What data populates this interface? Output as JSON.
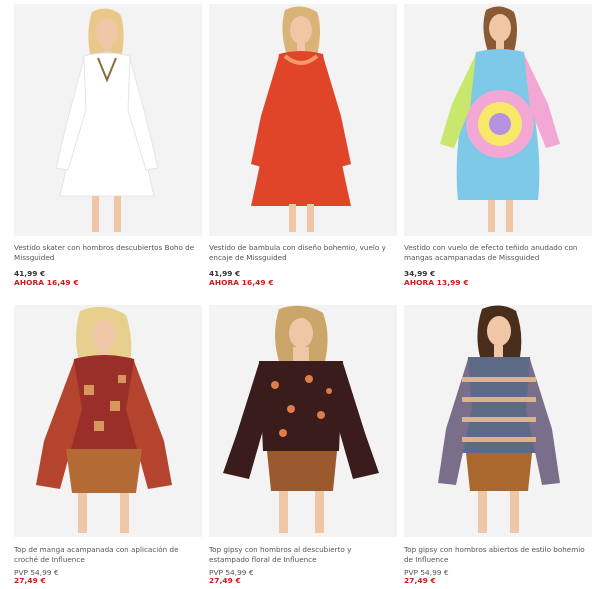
{
  "products": [
    {
      "description": "Vestido skater con hombros descubiertos Boho de Missguided",
      "price": "41,99 €",
      "sale_price": "AHORA 16,49 €",
      "image_icon": "model-white-dress-image",
      "colors": {
        "garment": "#ffffff",
        "background": "#f3f3f3"
      }
    },
    {
      "description": "Vestido de bambula con diseño bohemio, vuelo y encaje de Missguided",
      "price": "41,99 €",
      "sale_price": "AHORA 16,49 €",
      "image_icon": "model-red-dress-image",
      "colors": {
        "garment": "#e0452a",
        "background": "#f3f3f3"
      }
    },
    {
      "description": "Vestido con vuelo de efecto teñido anudado con mangas acampanadas de Missguided",
      "price": "34,99 €",
      "sale_price": "AHORA 13,99 €",
      "image_icon": "model-tie-dye-dress-image",
      "colors": {
        "garment": "#7ec8e8",
        "background": "#f3f3f3"
      }
    },
    {
      "description": "Top de manga acampanada con aplicación de croché de Influence",
      "price": "PVP 54,99 €",
      "sale_price": "27,49 €",
      "image_icon": "model-paisley-top-image",
      "colors": {
        "garment": "#9a2f2a",
        "background": "#f3f3f3"
      }
    },
    {
      "description": "Top gipsy con hombros al descubierto y estampado floral de Influence",
      "price": "PVP 54,99 €",
      "sale_price": "27,49 €",
      "image_icon": "model-floral-top-image",
      "colors": {
        "garment": "#3a1c1c",
        "background": "#f3f3f3"
      }
    },
    {
      "description": "Top gipsy con hombros abiertos de estilo bohemio de Influence",
      "price": "PVP 54,99 €",
      "sale_price": "27,49 €",
      "image_icon": "model-striped-top-image",
      "colors": {
        "garment": "#5c6a86",
        "background": "#f3f3f3"
      }
    }
  ],
  "colors": {
    "sale": "#d01818",
    "text": "#555555"
  }
}
